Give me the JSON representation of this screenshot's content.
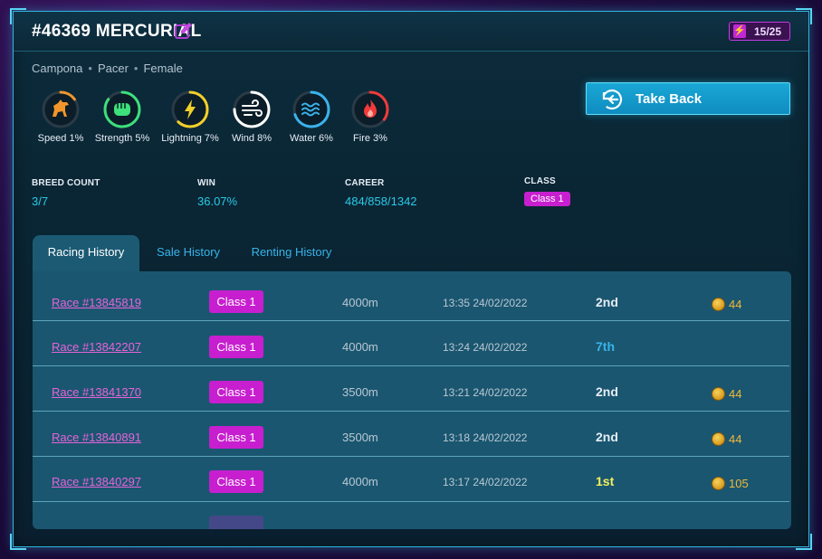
{
  "header": {
    "title": "#46369 MERCURIAL",
    "energy": "15/25"
  },
  "subtitle": {
    "items": [
      "Campona",
      "Pacer",
      "Female"
    ]
  },
  "stats": [
    {
      "name": "Speed",
      "value": "1%",
      "icon": "horse-icon",
      "color": "#f2962b",
      "progress": 0.15
    },
    {
      "name": "Strength",
      "value": "5%",
      "icon": "fist-icon",
      "color": "#3de07a",
      "progress": 0.85
    },
    {
      "name": "Lightning",
      "value": "7%",
      "icon": "lightning-icon",
      "color": "#f3cf2a",
      "progress": 0.62
    },
    {
      "name": "Wind",
      "value": "8%",
      "icon": "wind-icon",
      "color": "#ffffff",
      "progress": 0.75
    },
    {
      "name": "Water",
      "value": "6%",
      "icon": "water-icon",
      "color": "#3ab2ec",
      "progress": 0.7
    },
    {
      "name": "Fire",
      "value": "3%",
      "icon": "fire-icon",
      "color": "#f23a3a",
      "progress": 0.35
    }
  ],
  "actions": {
    "take_back_label": "Take Back"
  },
  "info": {
    "breed_count_label": "BREED COUNT",
    "breed_count_value": "3/7",
    "win_label": "WIN",
    "win_value": "36.07%",
    "career_label": "CAREER",
    "career_value": "484/858/1342",
    "class_label": "CLASS",
    "class_value": "Class 1"
  },
  "tabs": [
    {
      "label": "Racing History",
      "active": true
    },
    {
      "label": "Sale History",
      "active": false
    },
    {
      "label": "Renting History",
      "active": false
    }
  ],
  "races": [
    {
      "race": "Race #13845819",
      "class": "Class 1",
      "distance": "4000m",
      "time": "13:35 24/02/2022",
      "place": "2nd",
      "place_color": "#e6edf5",
      "reward": "44"
    },
    {
      "race": "Race #13842207",
      "class": "Class 1",
      "distance": "4000m",
      "time": "13:24 24/02/2022",
      "place": "7th",
      "place_color": "#36b4ea",
      "reward": ""
    },
    {
      "race": "Race #13841370",
      "class": "Class 1",
      "distance": "3500m",
      "time": "13:21 24/02/2022",
      "place": "2nd",
      "place_color": "#e6edf5",
      "reward": "44"
    },
    {
      "race": "Race #13840891",
      "class": "Class 1",
      "distance": "3500m",
      "time": "13:18 24/02/2022",
      "place": "2nd",
      "place_color": "#e6edf5",
      "reward": "44"
    },
    {
      "race": "Race #13840297",
      "class": "Class 1",
      "distance": "4000m",
      "time": "13:17 24/02/2022",
      "place": "1st",
      "place_color": "#f3ef5a",
      "reward": "105"
    }
  ]
}
